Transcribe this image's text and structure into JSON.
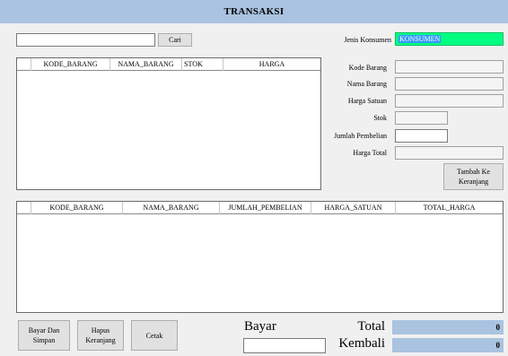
{
  "window": {
    "title": "TRANSAKSI"
  },
  "search": {
    "value": "",
    "button_label": "Cari"
  },
  "customer": {
    "label": "Jenis Konsumen",
    "value": "KONSUMEN",
    "accent": "#00ff80"
  },
  "form": {
    "kode_barang": {
      "label": "Kode Barang",
      "value": ""
    },
    "nama_barang": {
      "label": "Nama Barang",
      "value": ""
    },
    "harga_satuan": {
      "label": "Harga Satuan",
      "value": ""
    },
    "stok": {
      "label": "Stok",
      "value": ""
    },
    "jumlah_pembelian": {
      "label": "Jumlah Pembelian",
      "value": ""
    },
    "harga_total": {
      "label": "Harga Total",
      "value": ""
    },
    "add_cart_button": "Tambah Ke Keranjang"
  },
  "products_table": {
    "columns": [
      "KODE_BARANG",
      "NAMA_BARANG",
      "STOK",
      "HARGA"
    ]
  },
  "cart_table": {
    "columns": [
      "KODE_BARANG",
      "NAMA_BARANG",
      "JUMLAH_PEMBELIAN",
      "HARGA_SATUAN",
      "TOTAL_HARGA"
    ]
  },
  "actions": {
    "pay_save": "Bayar Dan Simpan",
    "clear_cart": "Hapus Keranjang",
    "print": "Cetak"
  },
  "payment": {
    "bayar_label": "Bayar",
    "bayar_value": "",
    "total_label": "Total",
    "total_value": "0",
    "kembali_label": "Kembali",
    "kembali_value": "0"
  },
  "colors": {
    "header": "#a9c3e0",
    "selection": "#3399ff"
  }
}
